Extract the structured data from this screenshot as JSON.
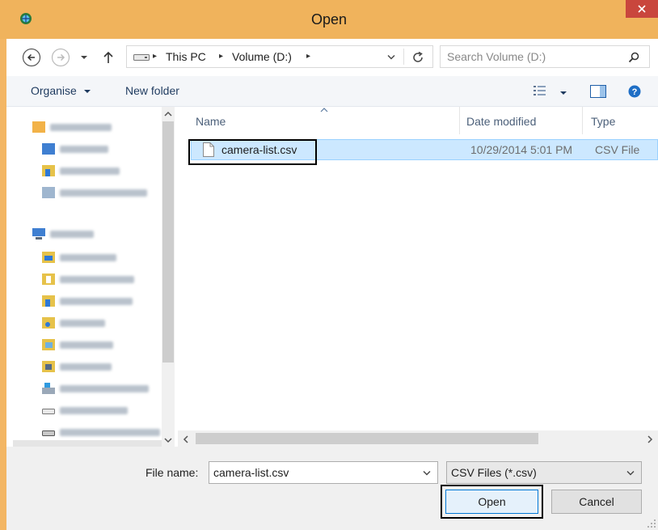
{
  "window": {
    "title": "Open",
    "accent": "#f0b35c",
    "close_color": "#c9463d"
  },
  "nav": {
    "back_icon": "back-arrow-icon",
    "forward_icon": "forward-arrow-icon",
    "recent_icon": "chevron-down-icon",
    "up_icon": "up-arrow-icon",
    "breadcrumbs": [
      "This PC",
      "Volume (D:)"
    ],
    "refresh_icon": "refresh-icon",
    "search_placeholder": "Search Volume (D:)"
  },
  "toolbar": {
    "organise": "Organise",
    "new_folder": "New folder"
  },
  "columns": {
    "name": "Name",
    "date_modified": "Date modified",
    "type": "Type"
  },
  "files": [
    {
      "name": "camera-list.csv",
      "date": "10/29/2014 5:01 PM",
      "type": "CSV File"
    }
  ],
  "sidebar": {
    "sections": [
      "Favourites",
      "This PC"
    ],
    "blurred": true
  },
  "footer": {
    "file_name_label": "File name:",
    "file_name_value": "camera-list.csv",
    "filter_value": "CSV Files (*.csv)",
    "open_label": "Open",
    "cancel_label": "Cancel"
  }
}
